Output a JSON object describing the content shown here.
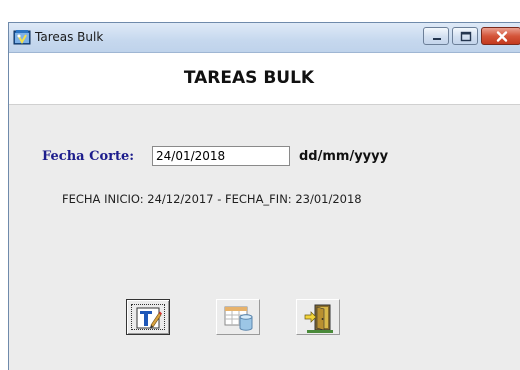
{
  "window": {
    "title": "Tareas Bulk",
    "controls": {
      "minimize": "minimize-icon",
      "maximize": "maximize-icon",
      "close": "close-icon"
    }
  },
  "header": {
    "title": "TAREAS BULK"
  },
  "form": {
    "fecha_label": "Fecha Corte:",
    "fecha_value": "24/01/2018",
    "format_hint": "dd/mm/yyyy",
    "range_text": "FECHA INICIO: 24/12/2017 - FECHA_FIN: 23/01/2018"
  },
  "toolbar": {
    "buttons": [
      {
        "icon": "edit-text-icon"
      },
      {
        "icon": "table-database-icon"
      },
      {
        "icon": "exit-door-icon"
      }
    ]
  },
  "colors": {
    "label_blue": "#1c1c8c",
    "close_red": "#c3391e"
  }
}
